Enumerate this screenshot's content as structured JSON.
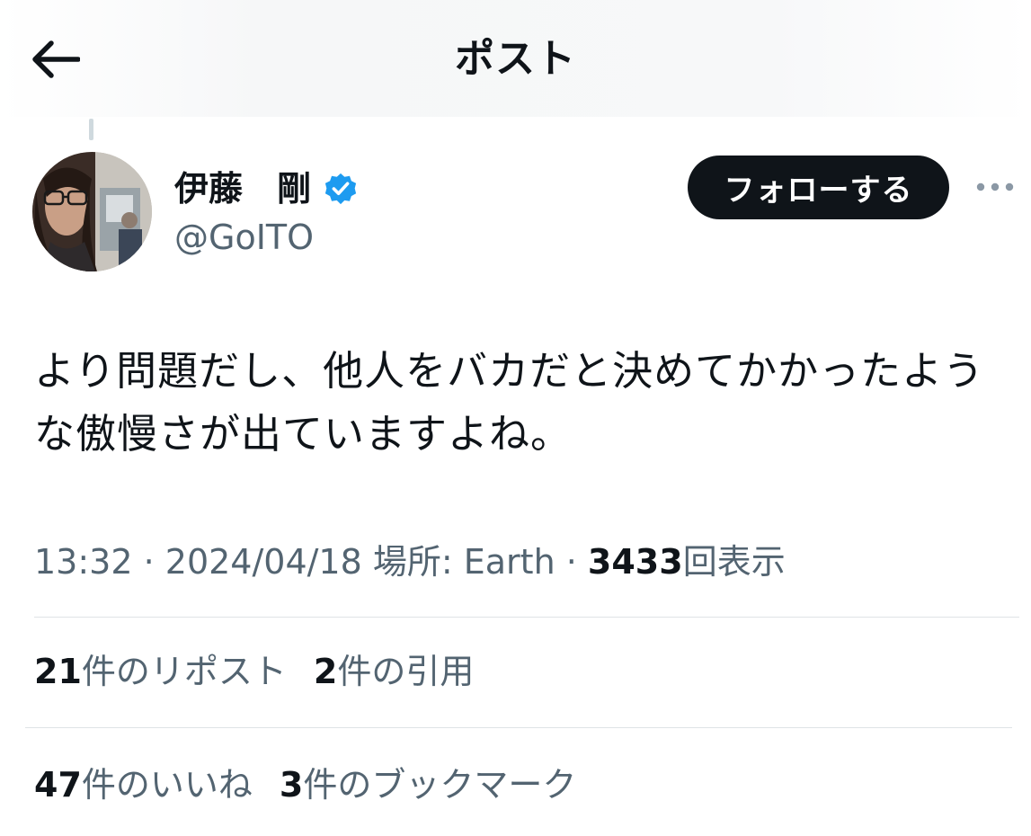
{
  "header": {
    "title": "ポスト",
    "back_icon": "arrow-left-icon"
  },
  "author": {
    "display_name": "伊藤　剛",
    "handle": "@GoITO",
    "verified": true,
    "verified_color": "#1d9bf0",
    "avatar_icon": "profile-photo"
  },
  "follow_button": {
    "label": "フォローする"
  },
  "more_icon": "more-dots-icon",
  "post": {
    "text_line1": "より問題だし、他人をバカだと決めてかかったよう",
    "text_line2": "な傲慢さが出ていますよね。"
  },
  "meta": {
    "time": "13:32",
    "sep1": " · ",
    "date": "2024/04/18",
    "location": " 場所: Earth",
    "sep2": " · ",
    "views": "3433",
    "views_label": "回表示"
  },
  "stats": {
    "reposts_count": "21",
    "reposts_label": "件のリポスト",
    "quotes_count": "2",
    "quotes_label": "件の引用",
    "likes_count": "47",
    "likes_label": "件のいいね",
    "bookmarks_count": "3",
    "bookmarks_label": "件のブックマーク"
  },
  "colors": {
    "text_primary": "#0f1419",
    "text_secondary": "#536471",
    "divider": "#dfe3e6",
    "accent": "#1d9bf0"
  }
}
